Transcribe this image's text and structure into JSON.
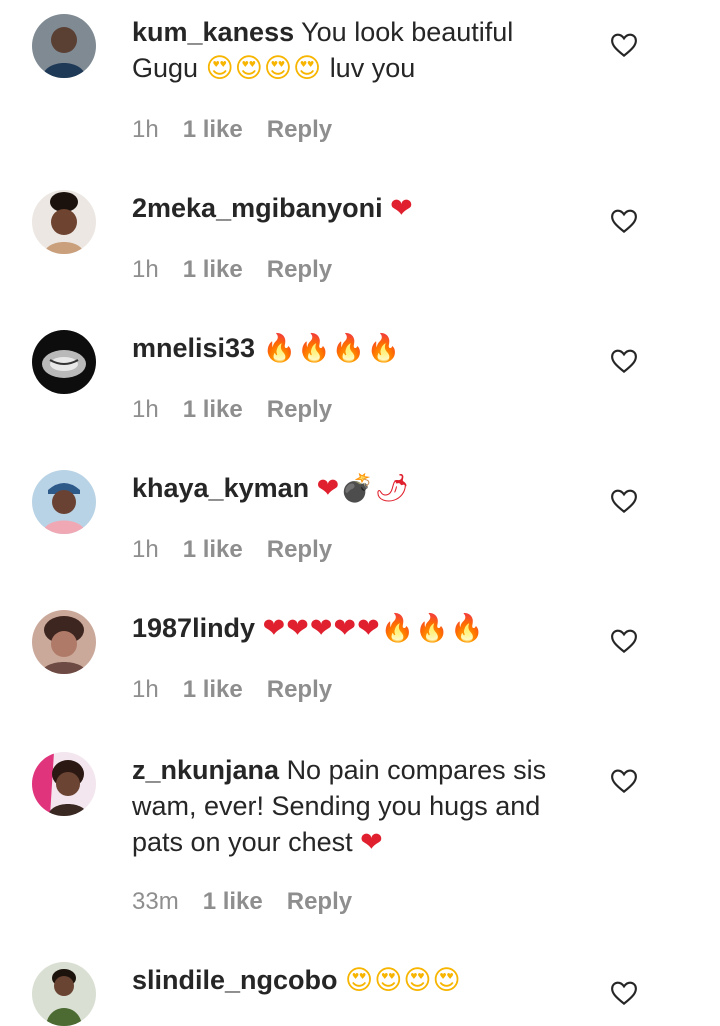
{
  "comments": [
    {
      "username": "kum_kaness",
      "text": "You look beautiful Gugu",
      "emoji_text": "😍😍😍😍",
      "text_after": "luv you",
      "time": "1h",
      "likes": "1 like",
      "reply": "Reply",
      "avatar_colors": [
        "#4a5a68",
        "#c9c2b8"
      ]
    },
    {
      "username": "2meka_mgibanyoni",
      "emoji_text": "❤",
      "time": "1h",
      "likes": "1 like",
      "reply": "Reply",
      "avatar_colors": [
        "#e8e2dc",
        "#3a2418"
      ]
    },
    {
      "username": "mnelisi33",
      "emoji_text": "🔥🔥🔥🔥",
      "time": "1h",
      "likes": "1 like",
      "reply": "Reply",
      "avatar_colors": [
        "#111111",
        "#cfcfcf"
      ]
    },
    {
      "username": "khaya_kyman",
      "emoji_text": "❤💣🌶",
      "time": "1h",
      "likes": "1 like",
      "reply": "Reply",
      "avatar_colors": [
        "#9fc4e0",
        "#e9a0a8"
      ]
    },
    {
      "username": "1987lindy",
      "emoji_text": "❤❤❤❤❤🔥🔥🔥",
      "time": "1h",
      "likes": "1 like",
      "reply": "Reply",
      "avatar_colors": [
        "#d7a79c",
        "#5a3a34"
      ]
    },
    {
      "username": "z_nkunjana",
      "text": "No pain compares sis wam, ever! Sending you hugs and pats on your chest",
      "emoji_text": "❤",
      "time": "33m",
      "likes": "1 like",
      "reply": "Reply",
      "avatar_colors": [
        "#e33a7a",
        "#4a2a22"
      ]
    },
    {
      "username": "slindile_ngcobo",
      "emoji_text": "😍😍😍😍",
      "time": "",
      "likes": "",
      "reply": "",
      "avatar_colors": [
        "#cfd8c8",
        "#3e5a2a"
      ]
    }
  ],
  "icons": {
    "like": "heart-outline-icon"
  }
}
